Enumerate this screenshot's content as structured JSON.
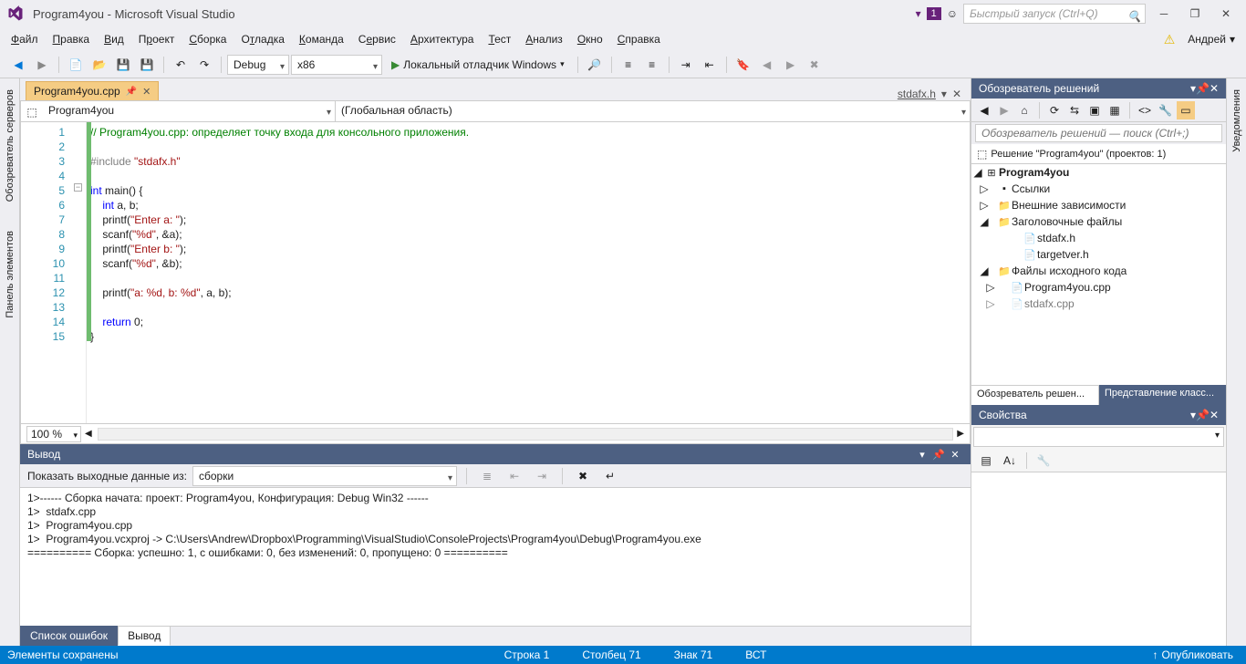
{
  "title": "Program4you - Microsoft Visual Studio",
  "quicklaunch_placeholder": "Быстрый запуск (Ctrl+Q)",
  "user": "Андрей",
  "notifications_badge": "1",
  "menu": [
    "Файл",
    "Правка",
    "Вид",
    "Проект",
    "Сборка",
    "Отладка",
    "Команда",
    "Сервис",
    "Архитектура",
    "Тест",
    "Анализ",
    "Окно",
    "Справка"
  ],
  "menu_underline_idx": [
    0,
    0,
    0,
    1,
    0,
    1,
    0,
    1,
    0,
    0,
    0,
    0,
    0
  ],
  "toolbar": {
    "config": "Debug",
    "platform": "x86",
    "run_label": "Локальный отладчик Windows"
  },
  "left_tabs": [
    "Обозреватель серверов",
    "Панель элементов"
  ],
  "right_tabs": [
    "Уведомления"
  ],
  "doc_tab": "Program4you.cpp",
  "prev_doc": "stdafx.h",
  "nav": {
    "left": "Program4you",
    "right": "(Глобальная область)"
  },
  "zoom": "100 %",
  "code": {
    "lines": 15,
    "l1": "// Program4you.cpp: определяет точку входа для консольного приложения.",
    "l3_pp": "#include ",
    "l3_str": "\"stdafx.h\"",
    "l5_kw": "int",
    "l5_rest": " main() {",
    "l6_kw_pad": "    int",
    "l6_rest": " a, b;",
    "l7_a": "    printf(",
    "l7_s": "\"Enter a: \"",
    "l7_b": ");",
    "l8_a": "    scanf(",
    "l8_s": "\"%d\"",
    "l8_b": ", &a);",
    "l9_a": "    printf(",
    "l9_s": "\"Enter b: \"",
    "l9_b": ");",
    "l10_a": "    scanf(",
    "l10_s": "\"%d\"",
    "l10_b": ", &b);",
    "l12_a": "    printf(",
    "l12_s": "\"a: %d, b: %d\"",
    "l12_b": ", a, b);",
    "l14_kw_pad": "    return",
    "l14_rest": " 0;",
    "l15": "}"
  },
  "output": {
    "title": "Вывод",
    "source_label": "Показать выходные данные из:",
    "source_value": "сборки",
    "lines": [
      "1>------ Сборка начата: проект: Program4you, Конфигурация: Debug Win32 ------",
      "1>  stdafx.cpp",
      "1>  Program4you.cpp",
      "1>  Program4you.vcxproj -> C:\\Users\\Andrew\\Dropbox\\Programming\\VisualStudio\\ConsoleProjects\\Program4you\\Debug\\Program4you.exe",
      "========== Сборка: успешно: 1, с ошибками: 0, без изменений: 0, пропущено: 0 =========="
    ]
  },
  "bottom_tabs": {
    "errors": "Список ошибок",
    "output": "Вывод"
  },
  "solution": {
    "title": "Обозреватель решений",
    "search_placeholder": "Обозреватель решений — поиск (Ctrl+;)",
    "root": "Решение \"Program4you\" (проектов: 1)",
    "project": "Program4you",
    "refs": "Ссылки",
    "ext": "Внешние зависимости",
    "headers": "Заголовочные файлы",
    "h1": "stdafx.h",
    "h2": "targetver.h",
    "sources": "Файлы исходного кода",
    "s1": "Program4you.cpp",
    "s2": "stdafx.cpp",
    "tab_explorer": "Обозреватель решен...",
    "tab_class": "Представление класс..."
  },
  "properties": {
    "title": "Свойства"
  },
  "status": {
    "left": "Элементы сохранены",
    "line": "Строка 1",
    "col": "Столбец 71",
    "char": "Знак 71",
    "ins": "ВСТ",
    "publish": "Опубликовать"
  }
}
